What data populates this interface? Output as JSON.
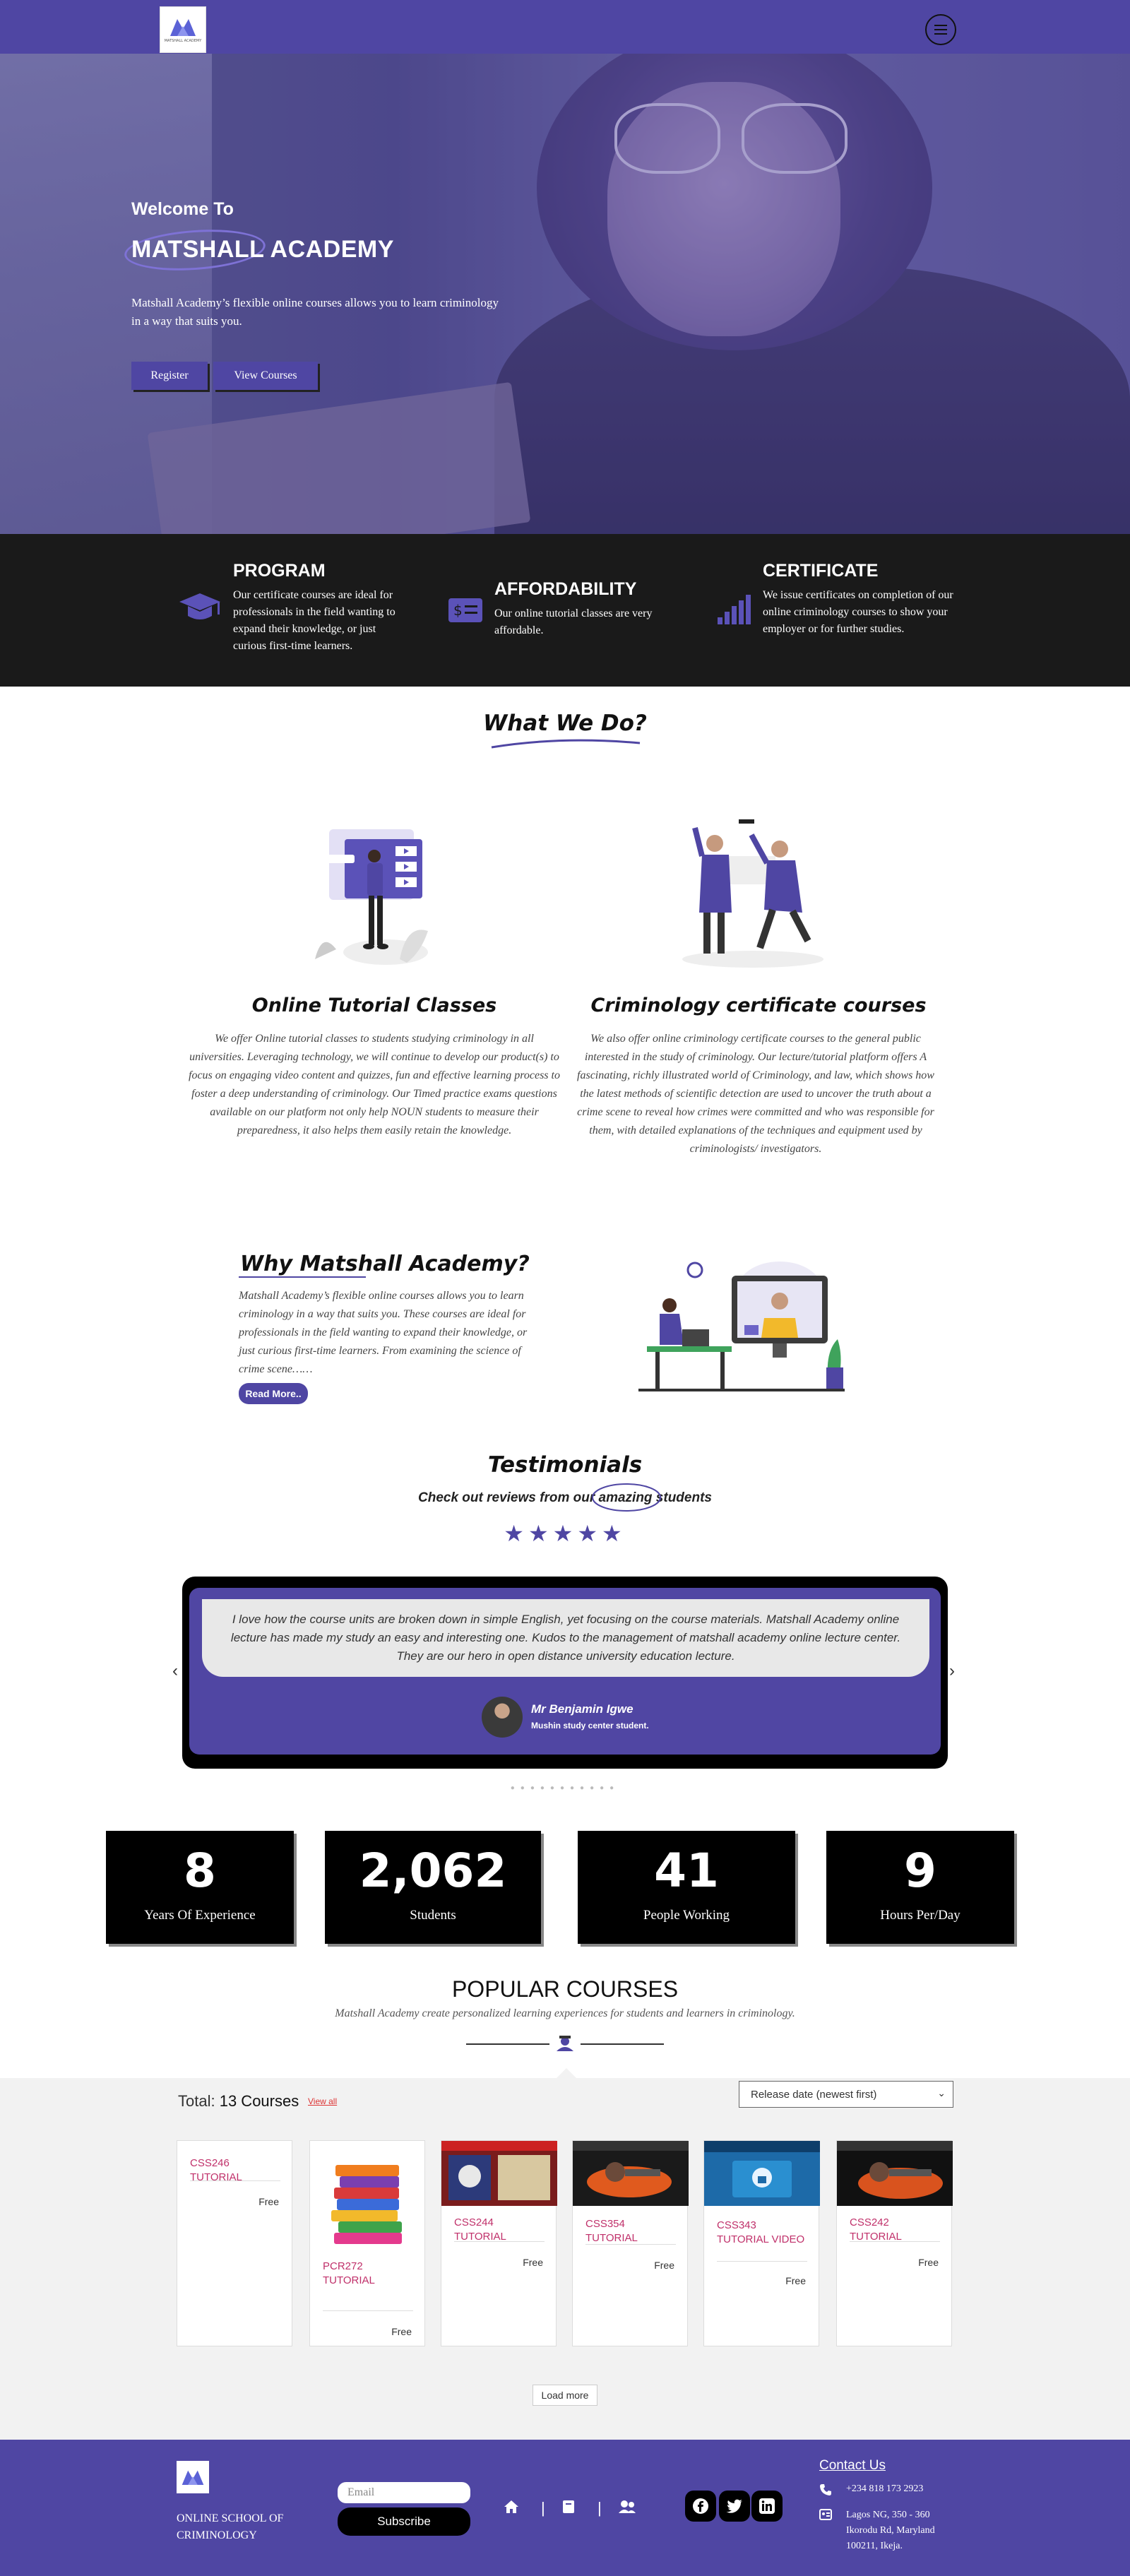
{
  "header": {
    "logo_text": "MATSHALL ACADEMY",
    "menu_icon": "hamburger-menu-icon"
  },
  "hero": {
    "welcome": "Welcome To",
    "title": "MATSHALL ACADEMY",
    "text": "Matshall Academy’s flexible online courses allows you to learn criminology in a way that suits you.",
    "register_label": "Register",
    "view_courses_label": "View Courses"
  },
  "features": [
    {
      "title": "PROGRAM",
      "text": "Our certificate courses are ideal for professionals in the field wanting to expand their knowledge, or just curious first-time learners.",
      "icon": "graduation-cap-icon"
    },
    {
      "title": "AFFORDABILITY",
      "text": "Our online tutorial classes are very affordable.",
      "icon": "money-icon"
    },
    {
      "title": "CERTIFICATE",
      "text": "We issue certificates on completion of our online criminology courses to show your employer or for further studies.",
      "icon": "signal-bars-icon"
    }
  ],
  "what_we_do": {
    "title": "What We Do?",
    "online": {
      "title": "Online Tutorial Classes",
      "text": "We offer Online tutorial classes to students studying criminology in all universities. Leveraging technology, we will continue to develop our product(s) to focus on engaging video content and quizzes, fun and effective learning process to foster a deep understanding of criminology. Our Timed practice exams questions available on our platform not only help NOUN students to measure their preparedness, it also helps them easily retain the knowledge."
    },
    "certificate": {
      "title": "Criminology certificate courses",
      "text": "We also offer online criminology certificate courses to the general public interested in the study of criminology. Our lecture/tutorial platform offers A fascinating, richly illustrated world of Criminology, and law, which shows how the latest methods of scientific detection are used to uncover the truth about a crime scene to reveal how crimes were committed and who was responsible for them, with detailed explanations of the techniques and equipment used by criminologists/ investigators."
    }
  },
  "why": {
    "title": "Why Matshall Academy?",
    "text": "Matshall Academy’s flexible online courses allows you to learn criminology in a way that suits you. These courses are ideal for professionals in the field wanting to expand their knowledge, or just curious first-time learners. From examining the science of crime scene……",
    "read_more": "Read More.."
  },
  "testimonials": {
    "title": "Testimonials",
    "subtitle": "Check out reviews from our amazing students",
    "stars": "★★★★★",
    "quote": "I love how the course units are broken down in simple English, yet focusing on the course materials. Matshall Academy online lecture has made my study an easy and interesting one. Kudos to the management of matshall academy online lecture center. They are our hero in open distance university education lecture.",
    "name": "Mr Benjamin Igwe",
    "role": "Mushin study center student.",
    "prev": "‹",
    "next": "›",
    "dots": "●●●●●●●●●●●"
  },
  "stats": [
    {
      "number": "8",
      "label": "Years Of Experience"
    },
    {
      "number": "2,062",
      "label": "Students"
    },
    {
      "number": "41",
      "label": "People Working"
    },
    {
      "number": "9",
      "label": "Hours Per/Day"
    }
  ],
  "popular": {
    "title": "POPULAR COURSES",
    "subtitle": "Matshall Academy create personalized learning experiences for students and learners in criminology.",
    "total_prefix": "Total:",
    "total_count": "13 Courses",
    "view_all": "View all",
    "sort_value": "Release date (newest first)",
    "courses": [
      {
        "title": "CSS246 TUTORIAL",
        "price": "Free"
      },
      {
        "title": "PCR272 TUTORIAL",
        "price": "Free"
      },
      {
        "title": "CSS244 TUTORIAL",
        "price": "Free"
      },
      {
        "title": "CSS354 TUTORIAL",
        "price": "Free"
      },
      {
        "title": "CSS343 TUTORIAL VIDEO",
        "price": "Free"
      },
      {
        "title": "CSS242 TUTORIAL",
        "price": "Free"
      }
    ],
    "load_more": "Load more"
  },
  "footer": {
    "school": "ONLINE SCHOOL OF CRIMINOLOGY",
    "email_placeholder": "Email",
    "subscribe": "Subscribe",
    "contact_title": "Contact Us",
    "phone": "+234 818 173 2923",
    "address": "Lagos NG, 350 - 360 Ikorodu Rd, Maryland 100211, Ikeja."
  },
  "colors": {
    "brand": "#4f46a3",
    "dark": "#1a1a1a",
    "accent_link": "#c0306a"
  }
}
